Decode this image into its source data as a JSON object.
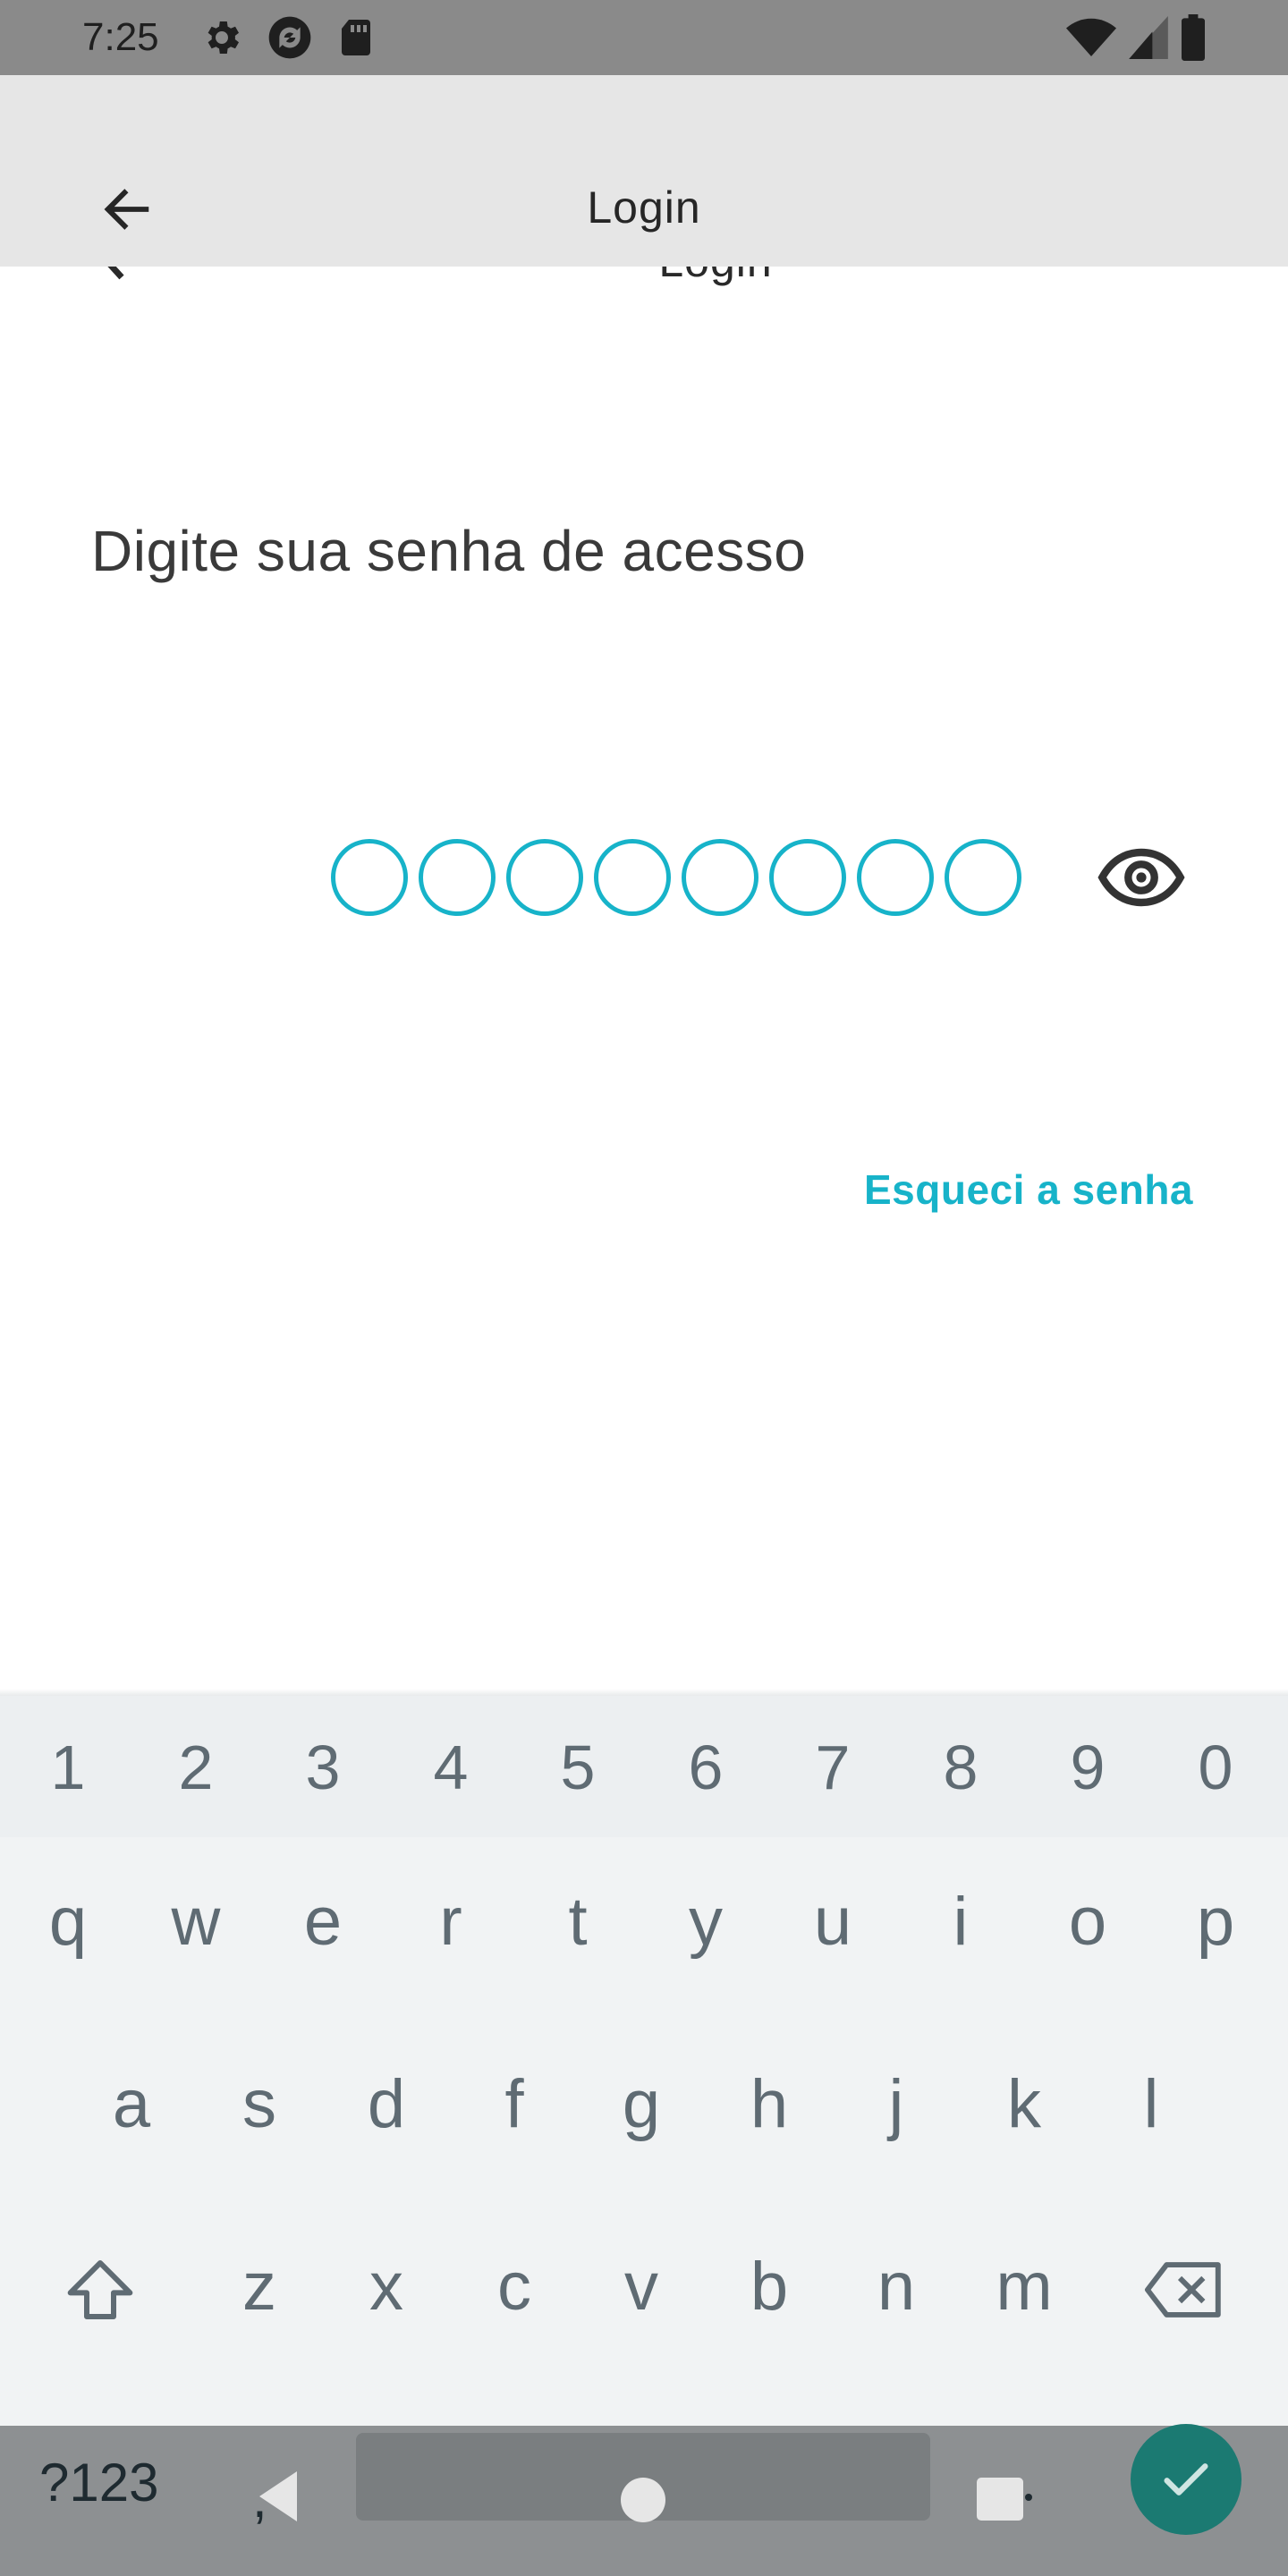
{
  "status_bar": {
    "time": "7:25",
    "left_icons": [
      "gear-icon",
      "sync-icon",
      "sd-card-icon"
    ],
    "right_icons": [
      "wifi-icon",
      "signal-icon",
      "battery-icon"
    ]
  },
  "app_bar": {
    "title": "Login",
    "back_icon": "arrow-back-icon"
  },
  "ghost_title": "Login",
  "content": {
    "prompt": "Digite sua senha de acesso",
    "pin_length": 8,
    "pin_filled": 0,
    "visibility_icon": "eye-icon",
    "forgot_password": "Esqueci a senha"
  },
  "colors": {
    "accent": "#17b3c9",
    "app_bar_bg": "#e6e6e6",
    "status_bar_bg": "#8a8a8a",
    "keyboard_bg": "#f1f3f4",
    "key_text": "#5f6b73",
    "enter_key": "#1b7a72"
  },
  "keyboard": {
    "number_row": [
      "1",
      "2",
      "3",
      "4",
      "5",
      "6",
      "7",
      "8",
      "9",
      "0"
    ],
    "row1": [
      "q",
      "w",
      "e",
      "r",
      "t",
      "y",
      "u",
      "i",
      "o",
      "p"
    ],
    "row2": [
      "a",
      "s",
      "d",
      "f",
      "g",
      "h",
      "j",
      "k",
      "l"
    ],
    "row3": [
      "z",
      "x",
      "c",
      "v",
      "b",
      "n",
      "m"
    ],
    "shift_icon": "shift-icon",
    "backspace_icon": "backspace-icon",
    "mode_switch": "?123",
    "comma": ",",
    "period": ".",
    "enter_icon": "check-icon"
  },
  "nav_bar": {
    "icons": [
      "nav-back-icon",
      "nav-home-icon",
      "nav-recents-icon"
    ]
  }
}
